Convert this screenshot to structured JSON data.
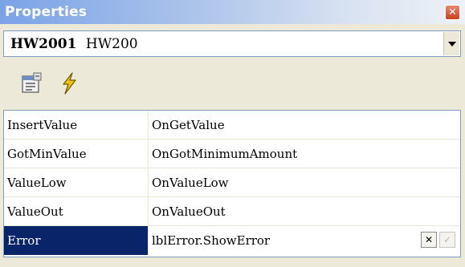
{
  "window": {
    "title": "Properties",
    "close_symbol": "✕"
  },
  "object_selector": {
    "name": "HW2001",
    "type": "HW200",
    "icon": "chevron-down-icon"
  },
  "toolbar": {
    "buttons": [
      {
        "icon": "properties-page-icon"
      },
      {
        "icon": "lightning-events-icon",
        "color": "#e8b400"
      }
    ]
  },
  "events": [
    {
      "name": "InsertValue",
      "value": "OnGetValue"
    },
    {
      "name": "GotMinValue",
      "value": "OnGotMinimumAmount"
    },
    {
      "name": "ValueLow",
      "value": "OnValueLow"
    },
    {
      "name": "ValueOut",
      "value": "OnValueOut"
    },
    {
      "name": "Error",
      "value": "lblError.ShowError",
      "selected": true
    }
  ],
  "edit_buttons": {
    "clear_symbol": "✕",
    "apply_symbol": "✓"
  },
  "colors": {
    "selection": "#0a246a",
    "titlebar_start": "#7aa3e6",
    "close_button": "#c9421f"
  }
}
